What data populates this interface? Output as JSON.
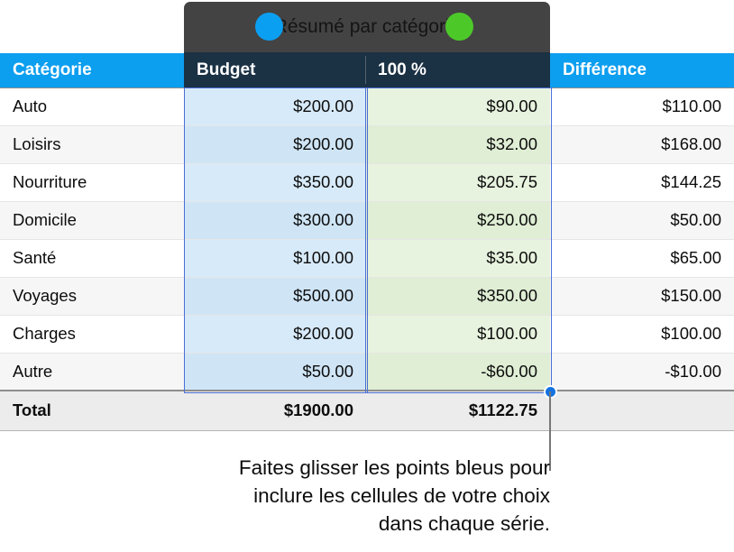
{
  "chart_overlay": {
    "title": "Résumé par catégorie",
    "series_dots": [
      {
        "name": "budget-series-dot",
        "color": "#0b9ff2"
      },
      {
        "name": "pct-series-dot",
        "color": "#4cc929"
      }
    ],
    "selected_headers": {
      "budget": "Budget",
      "percent": "100 %"
    }
  },
  "table": {
    "headers": {
      "category": "Catégorie",
      "budget": "Budget",
      "percent": "100 %",
      "difference": "Différence"
    },
    "rows": [
      {
        "category": "Auto",
        "budget": "$200.00",
        "percent": "$90.00",
        "difference": "$110.00"
      },
      {
        "category": "Loisirs",
        "budget": "$200.00",
        "percent": "$32.00",
        "difference": "$168.00"
      },
      {
        "category": "Nourriture",
        "budget": "$350.00",
        "percent": "$205.75",
        "difference": "$144.25"
      },
      {
        "category": "Domicile",
        "budget": "$300.00",
        "percent": "$250.00",
        "difference": "$50.00"
      },
      {
        "category": "Santé",
        "budget": "$100.00",
        "percent": "$35.00",
        "difference": "$65.00"
      },
      {
        "category": "Voyages",
        "budget": "$500.00",
        "percent": "$350.00",
        "difference": "$150.00"
      },
      {
        "category": "Charges",
        "budget": "$200.00",
        "percent": "$100.00",
        "difference": "$100.00"
      },
      {
        "category": "Autre",
        "budget": "$50.00",
        "percent": "-$60.00",
        "difference": "-$10.00"
      }
    ],
    "total": {
      "label": "Total",
      "budget": "$1900.00",
      "percent": "$1122.75",
      "difference": ""
    }
  },
  "callout": {
    "line1": "Faites glisser les points bleus pour",
    "line2": "inclure les cellules de votre choix",
    "line3": "dans chaque série."
  },
  "colors": {
    "header_blue": "#0c9eef",
    "header_dark": "#1b3144",
    "overlay_grey": "#434343",
    "selection_border": "#4a6fd6",
    "selection_blue_fill": "#d7eaf9",
    "selection_green_fill": "#e7f3de",
    "handle_blue": "#1372e0"
  }
}
